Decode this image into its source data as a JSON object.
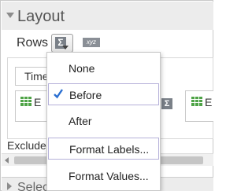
{
  "panel": {
    "title": "Layout",
    "rows_label": "Rows",
    "xyz_label": "xyz",
    "exclude_label": "Exclude",
    "next_section_title": "Selec"
  },
  "layout": {
    "time_cell": "Time",
    "cell_a_text": "E",
    "cell_b_text": "E"
  },
  "menu": {
    "items": [
      {
        "label": "None",
        "checked": false
      },
      {
        "label": "Before",
        "checked": true
      },
      {
        "label": "After",
        "checked": false
      },
      {
        "label": "Format Labels...",
        "checked": false
      },
      {
        "label": "Format Values...",
        "checked": false
      }
    ]
  },
  "colors": {
    "check": "#2a6fd1",
    "grid_icon": "#4ea346",
    "focus_border": "#b5b0d9"
  }
}
